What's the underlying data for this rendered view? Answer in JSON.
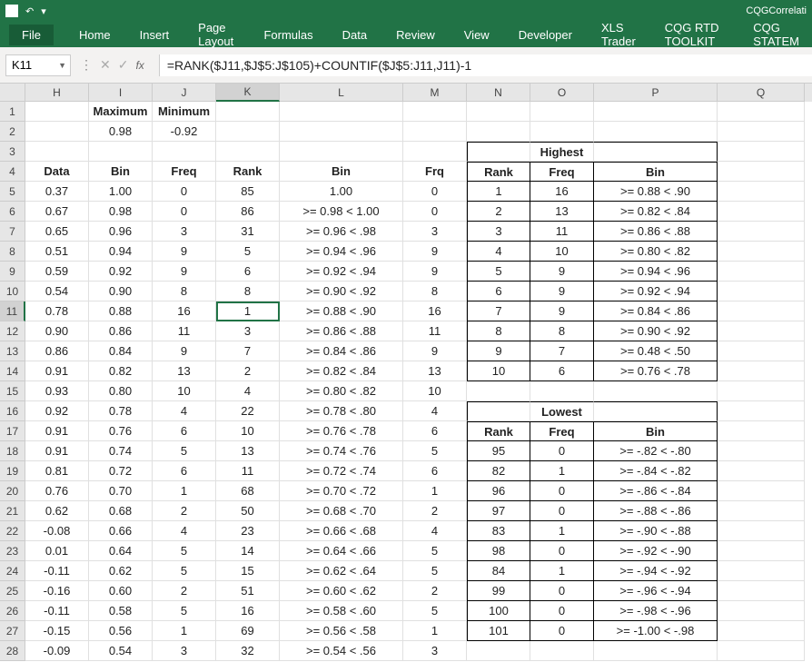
{
  "titlebar": {
    "doc": "CQGCorrelati"
  },
  "ribbon": {
    "file": "File",
    "tabs": [
      "Home",
      "Insert",
      "Page Layout",
      "Formulas",
      "Data",
      "Review",
      "View",
      "Developer",
      "XLS Trader",
      "CQG RTD TOOLKIT",
      "CQG STATEM"
    ]
  },
  "namebox": "K11",
  "formula": "=RANK($J11,$J$5:J$105)+COUNTIF($J$5:J11,J11)-1",
  "colwidths": {
    "H": 70,
    "I": 70,
    "J": 70,
    "K": 70,
    "L": 136,
    "M": 70,
    "N": 70,
    "O": 70,
    "P": 136,
    "Q": 96
  },
  "cols": [
    "H",
    "I",
    "J",
    "K",
    "L",
    "M",
    "N",
    "O",
    "P",
    "Q"
  ],
  "selected_col": "K",
  "selected_row": 11,
  "headers_main": {
    "I": "Maximum",
    "J": "Minimum"
  },
  "row2": {
    "I": "0.98",
    "J": "-0.92"
  },
  "row4": {
    "H": "Data",
    "I": "Bin",
    "J": "Freq",
    "K": "Rank",
    "L": "Bin",
    "M": "Frq",
    "N": "Rank",
    "O": "Freq",
    "P": "Bin"
  },
  "highest_title": "Highest",
  "lowest_title": "Lowest",
  "main_rows": [
    {
      "n": 5,
      "H": "0.37",
      "I": "1.00",
      "J": "0",
      "K": "85",
      "L": "1.00",
      "M": "0"
    },
    {
      "n": 6,
      "H": "0.67",
      "I": "0.98",
      "J": "0",
      "K": "86",
      "L": ">= 0.98 < 1.00",
      "M": "0"
    },
    {
      "n": 7,
      "H": "0.65",
      "I": "0.96",
      "J": "3",
      "K": "31",
      "L": ">= 0.96 < .98",
      "M": "3"
    },
    {
      "n": 8,
      "H": "0.51",
      "I": "0.94",
      "J": "9",
      "K": "5",
      "L": ">= 0.94 < .96",
      "M": "9"
    },
    {
      "n": 9,
      "H": "0.59",
      "I": "0.92",
      "J": "9",
      "K": "6",
      "L": ">= 0.92 < .94",
      "M": "9"
    },
    {
      "n": 10,
      "H": "0.54",
      "I": "0.90",
      "J": "8",
      "K": "8",
      "L": ">= 0.90 < .92",
      "M": "8"
    },
    {
      "n": 11,
      "H": "0.78",
      "I": "0.88",
      "J": "16",
      "K": "1",
      "L": ">= 0.88 < .90",
      "M": "16"
    },
    {
      "n": 12,
      "H": "0.90",
      "I": "0.86",
      "J": "11",
      "K": "3",
      "L": ">= 0.86 < .88",
      "M": "11"
    },
    {
      "n": 13,
      "H": "0.86",
      "I": "0.84",
      "J": "9",
      "K": "7",
      "L": ">= 0.84 < .86",
      "M": "9"
    },
    {
      "n": 14,
      "H": "0.91",
      "I": "0.82",
      "J": "13",
      "K": "2",
      "L": ">= 0.82 < .84",
      "M": "13"
    },
    {
      "n": 15,
      "H": "0.93",
      "I": "0.80",
      "J": "10",
      "K": "4",
      "L": ">= 0.80 < .82",
      "M": "10"
    },
    {
      "n": 16,
      "H": "0.92",
      "I": "0.78",
      "J": "4",
      "K": "22",
      "L": ">= 0.78 < .80",
      "M": "4"
    },
    {
      "n": 17,
      "H": "0.91",
      "I": "0.76",
      "J": "6",
      "K": "10",
      "L": ">= 0.76 < .78",
      "M": "6"
    },
    {
      "n": 18,
      "H": "0.91",
      "I": "0.74",
      "J": "5",
      "K": "13",
      "L": ">= 0.74 < .76",
      "M": "5"
    },
    {
      "n": 19,
      "H": "0.81",
      "I": "0.72",
      "J": "6",
      "K": "11",
      "L": ">= 0.72 < .74",
      "M": "6"
    },
    {
      "n": 20,
      "H": "0.76",
      "I": "0.70",
      "J": "1",
      "K": "68",
      "L": ">= 0.70 < .72",
      "M": "1"
    },
    {
      "n": 21,
      "H": "0.62",
      "I": "0.68",
      "J": "2",
      "K": "50",
      "L": ">= 0.68 < .70",
      "M": "2"
    },
    {
      "n": 22,
      "H": "-0.08",
      "I": "0.66",
      "J": "4",
      "K": "23",
      "L": ">= 0.66 < .68",
      "M": "4"
    },
    {
      "n": 23,
      "H": "0.01",
      "I": "0.64",
      "J": "5",
      "K": "14",
      "L": ">= 0.64 < .66",
      "M": "5"
    },
    {
      "n": 24,
      "H": "-0.11",
      "I": "0.62",
      "J": "5",
      "K": "15",
      "L": ">= 0.62 < .64",
      "M": "5"
    },
    {
      "n": 25,
      "H": "-0.16",
      "I": "0.60",
      "J": "2",
      "K": "51",
      "L": ">= 0.60 < .62",
      "M": "2"
    },
    {
      "n": 26,
      "H": "-0.11",
      "I": "0.58",
      "J": "5",
      "K": "16",
      "L": ">= 0.58 < .60",
      "M": "5"
    },
    {
      "n": 27,
      "H": "-0.15",
      "I": "0.56",
      "J": "1",
      "K": "69",
      "L": ">= 0.56 < .58",
      "M": "1"
    },
    {
      "n": 28,
      "H": "-0.09",
      "I": "0.54",
      "J": "3",
      "K": "32",
      "L": ">= 0.54 < .56",
      "M": "3"
    }
  ],
  "highest": [
    {
      "N": "1",
      "O": "16",
      "P": ">= 0.88 < .90"
    },
    {
      "N": "2",
      "O": "13",
      "P": ">= 0.82 < .84"
    },
    {
      "N": "3",
      "O": "11",
      "P": ">= 0.86 < .88"
    },
    {
      "N": "4",
      "O": "10",
      "P": ">= 0.80 < .82"
    },
    {
      "N": "5",
      "O": "9",
      "P": ">= 0.94 < .96"
    },
    {
      "N": "6",
      "O": "9",
      "P": ">= 0.92 < .94"
    },
    {
      "N": "7",
      "O": "9",
      "P": ">= 0.84 < .86"
    },
    {
      "N": "8",
      "O": "8",
      "P": ">= 0.90 < .92"
    },
    {
      "N": "9",
      "O": "7",
      "P": ">= 0.48 < .50"
    },
    {
      "N": "10",
      "O": "6",
      "P": ">= 0.76 < .78"
    }
  ],
  "lowest_hdr": {
    "N": "Rank",
    "O": "Freq",
    "P": "Bin"
  },
  "lowest": [
    {
      "N": "95",
      "O": "0",
      "P": ">= -.82 < -.80"
    },
    {
      "N": "82",
      "O": "1",
      "P": ">= -.84 < -.82"
    },
    {
      "N": "96",
      "O": "0",
      "P": ">= -.86 < -.84"
    },
    {
      "N": "97",
      "O": "0",
      "P": ">= -.88 < -.86"
    },
    {
      "N": "83",
      "O": "1",
      "P": ">= -.90 < -.88"
    },
    {
      "N": "98",
      "O": "0",
      "P": ">= -.92 < -.90"
    },
    {
      "N": "84",
      "O": "1",
      "P": ">= -.94 < -.92"
    },
    {
      "N": "99",
      "O": "0",
      "P": ">= -.96 < -.94"
    },
    {
      "N": "100",
      "O": "0",
      "P": ">= -.98 < -.96"
    },
    {
      "N": "101",
      "O": "0",
      "P": ">= -1.00 < -.98"
    }
  ]
}
